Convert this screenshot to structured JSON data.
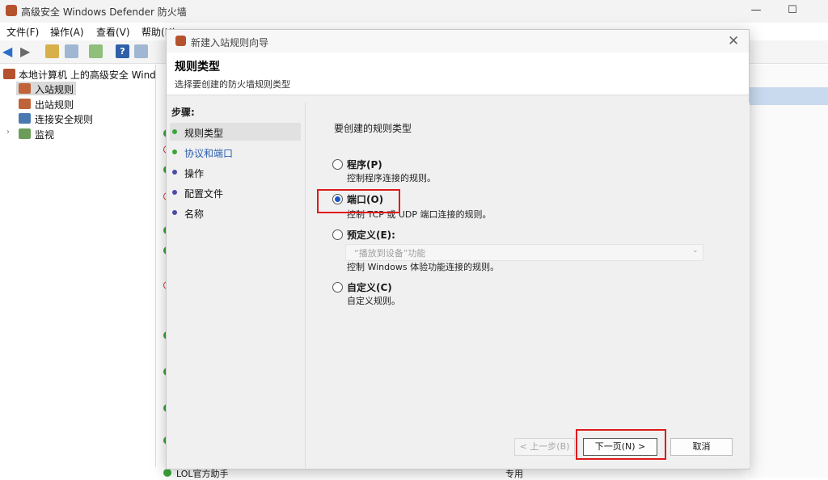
{
  "app": {
    "title": "高级安全 Windows Defender 防火墙",
    "menu": [
      "文件(F)",
      "操作(A)",
      "查看(V)",
      "帮助(H)"
    ]
  },
  "tree": {
    "root": "本地计算机 上的高级安全 Wind",
    "items": [
      "入站规则",
      "出站规则",
      "连接安全规则",
      "监视"
    ]
  },
  "list": {
    "bottom_row_name": "LOL官方助手",
    "bottom_row_profile": "专用"
  },
  "dialog": {
    "title": "新建入站规则向导",
    "heading": "规则类型",
    "subheading": "选择要创建的防火墙规则类型",
    "steps_title": "步骤:",
    "steps": [
      "规则类型",
      "协议和端口",
      "操作",
      "配置文件",
      "名称"
    ],
    "question": "要创建的规则类型",
    "options": [
      {
        "label": "程序(P)",
        "desc": "控制程序连接的规则。",
        "selected": false
      },
      {
        "label": "端口(O)",
        "desc": "控制 TCP 或 UDP 端口连接的规则。",
        "selected": true
      },
      {
        "label": "预定义(E):",
        "desc": "控制 Windows 体验功能连接的规则。",
        "selected": false,
        "select_value": "“播放到设备”功能"
      },
      {
        "label": "自定义(C)",
        "desc": "自定义规则。",
        "selected": false
      }
    ],
    "buttons": {
      "back": "< 上一步(B)",
      "next": "下一页(N) >",
      "cancel": "取消"
    }
  }
}
